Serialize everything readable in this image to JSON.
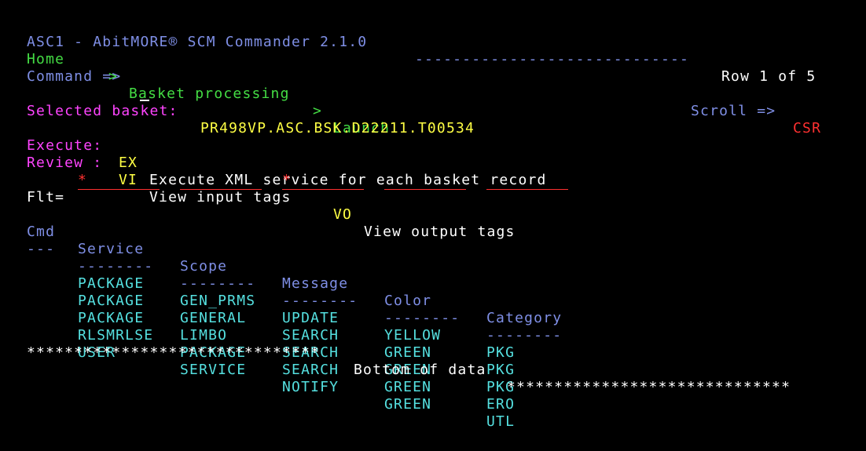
{
  "header": {
    "title": "ASC1 - AbitMORE® SCM Commander 2.1.0",
    "dashes": "-----------------------------",
    "row_info": "Row 1 of 5"
  },
  "breadcrumb": {
    "home": "Home",
    "sep1": ">",
    "item1": "Basket processing",
    "sep2": ">",
    "item2": "Launch"
  },
  "command": {
    "label": "Command =>",
    "value": "",
    "scroll_label": "Scroll =>",
    "scroll_value": "CSR"
  },
  "basket": {
    "label": "Selected basket:",
    "value": "PR498VP.ASC.BSK.D22211.T00534"
  },
  "actions": {
    "execute_label": "Execute:",
    "execute_code": "EX",
    "execute_desc": "Execute XML service for each basket record",
    "review_label": "Review :",
    "review_vi_code": "VI",
    "review_vi_desc": "View input tags",
    "review_vo_code": "VO",
    "review_vo_desc": "View output tags"
  },
  "filter": {
    "label": "Flt=",
    "values": [
      "*",
      "",
      "*",
      "",
      ""
    ]
  },
  "table": {
    "headers": [
      "Cmd",
      "Service",
      "Scope",
      "Message",
      "Color",
      "Category"
    ],
    "separators": [
      "---",
      "--------",
      "--------",
      "--------",
      "--------",
      "--------"
    ],
    "rows": [
      [
        "",
        "PACKAGE",
        "GEN_PRMS",
        "UPDATE",
        "YELLOW",
        "PKG"
      ],
      [
        "",
        "PACKAGE",
        "GENERAL",
        "SEARCH",
        "GREEN",
        "PKG"
      ],
      [
        "",
        "PACKAGE",
        "LIMBO",
        "SEARCH",
        "GREEN",
        "PKG"
      ],
      [
        "",
        "RLSMRLSE",
        "PACKAGE",
        "SEARCH",
        "GREEN",
        "ERO"
      ],
      [
        "",
        "USER",
        "SERVICE",
        "NOTIFY",
        "GREEN",
        "UTL"
      ]
    ]
  },
  "footer": {
    "stars_left": "*******************************",
    "text": "Bottom of data",
    "stars_right": "******************************"
  },
  "colors": {
    "background": "#000000",
    "blue": "#7f8fe6",
    "green": "#44dd44",
    "white": "#ffffff",
    "red": "#ff3030",
    "pink": "#ff44ff",
    "yellow": "#ffff44",
    "cyan": "#55e0e0"
  }
}
